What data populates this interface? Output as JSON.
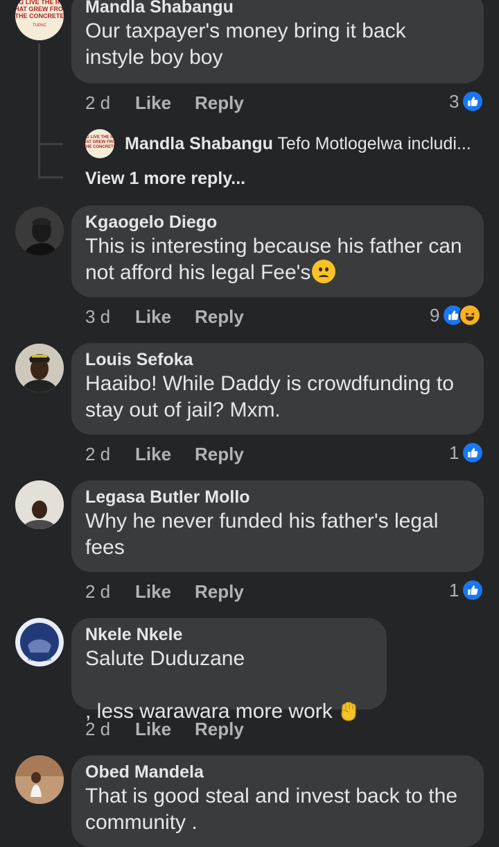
{
  "comments": [
    {
      "author": "Mandla Shabangu",
      "text": "Our taxpayer's money bring it back\ninstyle boy boy",
      "time": "2 d",
      "reaction_count": "3",
      "reactions": [
        "like-icon"
      ],
      "avatar_text": [
        "NG LIVE THE RO",
        "THAT GREW FROM",
        "THE CONCRETE",
        "TUPAC"
      ]
    },
    {
      "author": "Kgaogelo Diego",
      "text": "This is interesting because his father can\nnot afford his legal Fee's",
      "emoji": "confused-face",
      "time": "3 d",
      "reaction_count": "9",
      "reactions": [
        "like-icon",
        "haha-icon"
      ]
    },
    {
      "author": "Louis Sefoka",
      "text": "Haaibo! While Daddy is crowdfunding to\nstay out of jail? Mxm.",
      "time": "2 d",
      "reaction_count": "1",
      "reactions": [
        "like-icon"
      ]
    },
    {
      "author": "Legasa Butler Mollo",
      "text": "Why he never funded his father's legal\nfees",
      "time": "2 d",
      "reaction_count": "1",
      "reactions": [
        "like-icon"
      ]
    },
    {
      "author": "Nkele Nkele",
      "text": "Salute Duduzane\n, less warawara more work",
      "emoji": "raised-fist",
      "time": "2 d",
      "avatar_text": [
        "#WeAreZA"
      ]
    },
    {
      "author": "Obed Mandela",
      "text": "That is good steal and invest back to the\ncommunity ."
    }
  ],
  "reply_preview": {
    "author": "Mandla Shabangu",
    "text": "Tefo Motlogelwa includi..."
  },
  "view_more": "View 1 more reply...",
  "labels": {
    "like": "Like",
    "reply": "Reply"
  },
  "colors": {
    "background": "#242526",
    "bubble": "#3a3b3c",
    "like_blue": "#1877f2",
    "haha_yellow": "#f7b125"
  }
}
